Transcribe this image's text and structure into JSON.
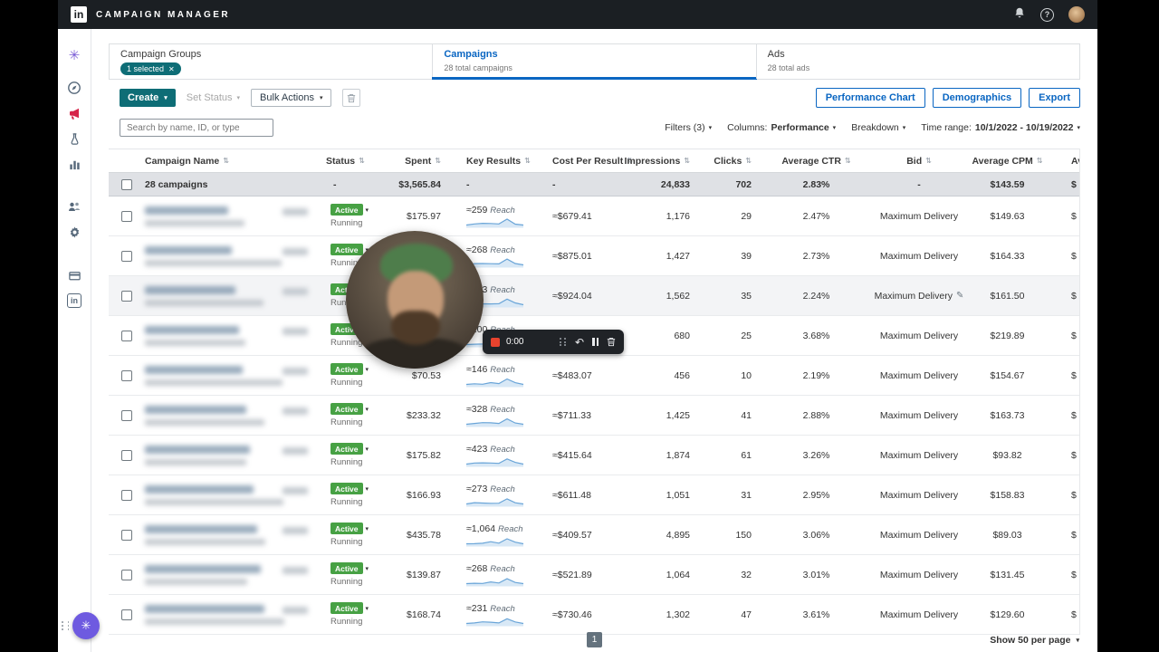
{
  "topnav": {
    "brand": "CAMPAIGN MANAGER",
    "icons": [
      "linkedin-logo",
      "bell",
      "help",
      "avatar"
    ]
  },
  "sidebar": {
    "icons": [
      "workspace-logo",
      "compass",
      "megaphone",
      "flask",
      "bar-chart",
      "audience",
      "gear",
      "billing-card",
      "linkedin"
    ]
  },
  "tabs": [
    {
      "label": "Campaign Groups",
      "badge": "1 selected",
      "active": false
    },
    {
      "label": "Campaigns",
      "sub": "28 total campaigns",
      "active": true
    },
    {
      "label": "Ads",
      "sub": "28 total ads",
      "active": false
    }
  ],
  "toolbar": {
    "create_label": "Create",
    "set_status_label": "Set Status",
    "bulk_actions_label": "Bulk Actions",
    "performance_chart_label": "Performance Chart",
    "demographics_label": "Demographics",
    "export_label": "Export"
  },
  "filters": {
    "search_placeholder": "Search by name, ID, or type",
    "filters_label": "Filters (3)",
    "columns_label": "Columns:",
    "columns_value": "Performance",
    "breakdown_label": "Breakdown",
    "time_range_label": "Time range:",
    "time_range_value": "10/1/2022 - 10/19/2022"
  },
  "table": {
    "columns": [
      "Campaign Name",
      "Status",
      "Spent",
      "Key Results",
      "Cost Per Result",
      "Impressions",
      "Clicks",
      "Average CTR",
      "Bid",
      "Average CPM",
      "Average"
    ],
    "summary": {
      "name": "28 campaigns",
      "status": "-",
      "spent": "$3,565.84",
      "key_results": "-",
      "cost_per_result": "-",
      "impressions": "24,833",
      "clicks": "702",
      "avg_ctr": "2.83%",
      "bid": "-",
      "avg_cpm": "$143.59",
      "extra": "$"
    },
    "rows": [
      {
        "status": "Active",
        "state": "Running",
        "spent": "$175.97",
        "key_results": "≈259",
        "key_results_unit": "Reach",
        "cost_per_result": "≈$679.41",
        "impressions": "1,176",
        "clicks": "29",
        "avg_ctr": "2.47%",
        "bid": "Maximum Delivery",
        "avg_cpm": "$149.63",
        "extra": "$"
      },
      {
        "status": "Active",
        "state": "Running",
        "spent": "",
        "key_results": "≈268",
        "key_results_unit": "Reach",
        "cost_per_result": "≈$875.01",
        "impressions": "1,427",
        "clicks": "39",
        "avg_ctr": "2.73%",
        "bid": "Maximum Delivery",
        "avg_cpm": "$164.33",
        "extra": "$"
      },
      {
        "status": "Active",
        "state": "Running",
        "spent": "",
        "key_results": "≈273",
        "key_results_unit": "Reach",
        "cost_per_result": "≈$924.04",
        "impressions": "1,562",
        "clicks": "35",
        "avg_ctr": "2.24%",
        "bid": "Maximum Delivery",
        "bid_edit": true,
        "avg_cpm": "$161.50",
        "extra": "$"
      },
      {
        "status": "Active",
        "state": "Running",
        "spent": "",
        "key_results": "≈100",
        "key_results_unit": "Reach",
        "cost_per_result": "",
        "impressions": "680",
        "clicks": "25",
        "avg_ctr": "3.68%",
        "bid": "Maximum Delivery",
        "avg_cpm": "$219.89",
        "extra": "$"
      },
      {
        "status": "Active",
        "state": "Running",
        "spent": "$70.53",
        "key_results": "≈146",
        "key_results_unit": "Reach",
        "cost_per_result": "≈$483.07",
        "impressions": "456",
        "clicks": "10",
        "avg_ctr": "2.19%",
        "bid": "Maximum Delivery",
        "avg_cpm": "$154.67",
        "extra": "$"
      },
      {
        "status": "Active",
        "state": "Running",
        "spent": "$233.32",
        "key_results": "≈328",
        "key_results_unit": "Reach",
        "cost_per_result": "≈$711.33",
        "impressions": "1,425",
        "clicks": "41",
        "avg_ctr": "2.88%",
        "bid": "Maximum Delivery",
        "avg_cpm": "$163.73",
        "extra": "$"
      },
      {
        "status": "Active",
        "state": "Running",
        "spent": "$175.82",
        "key_results": "≈423",
        "key_results_unit": "Reach",
        "cost_per_result": "≈$415.64",
        "impressions": "1,874",
        "clicks": "61",
        "avg_ctr": "3.26%",
        "bid": "Maximum Delivery",
        "avg_cpm": "$93.82",
        "extra": "$"
      },
      {
        "status": "Active",
        "state": "Running",
        "spent": "$166.93",
        "key_results": "≈273",
        "key_results_unit": "Reach",
        "cost_per_result": "≈$611.48",
        "impressions": "1,051",
        "clicks": "31",
        "avg_ctr": "2.95%",
        "bid": "Maximum Delivery",
        "avg_cpm": "$158.83",
        "extra": "$"
      },
      {
        "status": "Active",
        "state": "Running",
        "spent": "$435.78",
        "key_results": "≈1,064",
        "key_results_unit": "Reach",
        "cost_per_result": "≈$409.57",
        "impressions": "4,895",
        "clicks": "150",
        "avg_ctr": "3.06%",
        "bid": "Maximum Delivery",
        "avg_cpm": "$89.03",
        "extra": "$"
      },
      {
        "status": "Active",
        "state": "Running",
        "spent": "$139.87",
        "key_results": "≈268",
        "key_results_unit": "Reach",
        "cost_per_result": "≈$521.89",
        "impressions": "1,064",
        "clicks": "32",
        "avg_ctr": "3.01%",
        "bid": "Maximum Delivery",
        "avg_cpm": "$131.45",
        "extra": "$"
      },
      {
        "status": "Active",
        "state": "Running",
        "spent": "$168.74",
        "key_results": "≈231",
        "key_results_unit": "Reach",
        "cost_per_result": "≈$730.46",
        "impressions": "1,302",
        "clicks": "47",
        "avg_ctr": "3.61%",
        "bid": "Maximum Delivery",
        "avg_cpm": "$129.60",
        "extra": "$"
      }
    ]
  },
  "recorder": {
    "time": "0:00"
  },
  "pagination": {
    "current_page": "1",
    "page_size_label": "Show 50 per page"
  }
}
